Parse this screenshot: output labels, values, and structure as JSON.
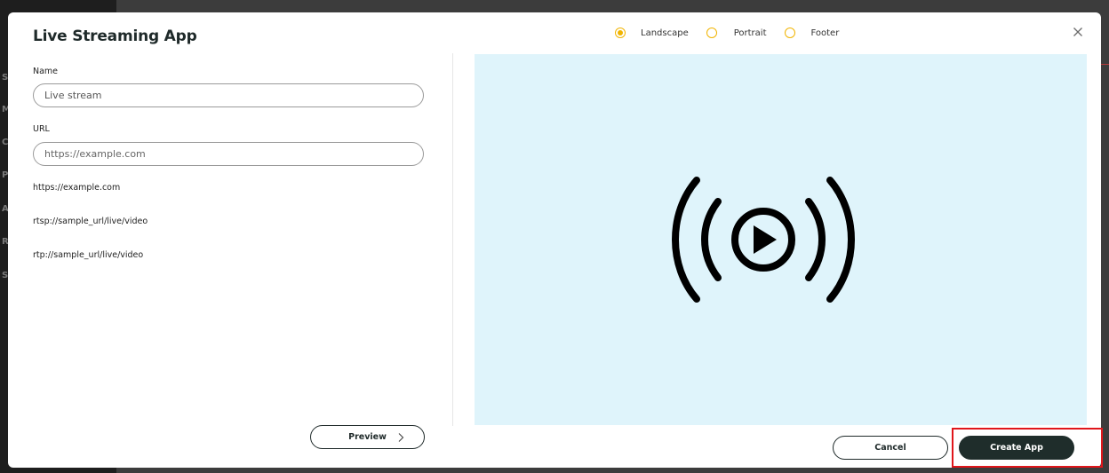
{
  "modal": {
    "title": "Live Streaming App",
    "layout_options": [
      {
        "label": "Landscape",
        "selected": true
      },
      {
        "label": "Portrait",
        "selected": false
      },
      {
        "label": "Footer",
        "selected": false
      }
    ]
  },
  "form": {
    "name_label": "Name",
    "name_value": "Live stream",
    "url_label": "URL",
    "url_placeholder": "https://example.com",
    "url_examples": [
      "https://example.com",
      "rtsp://sample_url/live/video",
      "rtp://sample_url/live/video"
    ],
    "preview_button": "Preview"
  },
  "preview": {
    "background_color": "#dff4fb",
    "icon": "live-stream-icon"
  },
  "actions": {
    "cancel_label": "Cancel",
    "create_label": "Create App"
  },
  "colors": {
    "accent": "#f1b400",
    "primary_button": "#1f2d2b",
    "highlight": "#e0161b"
  }
}
